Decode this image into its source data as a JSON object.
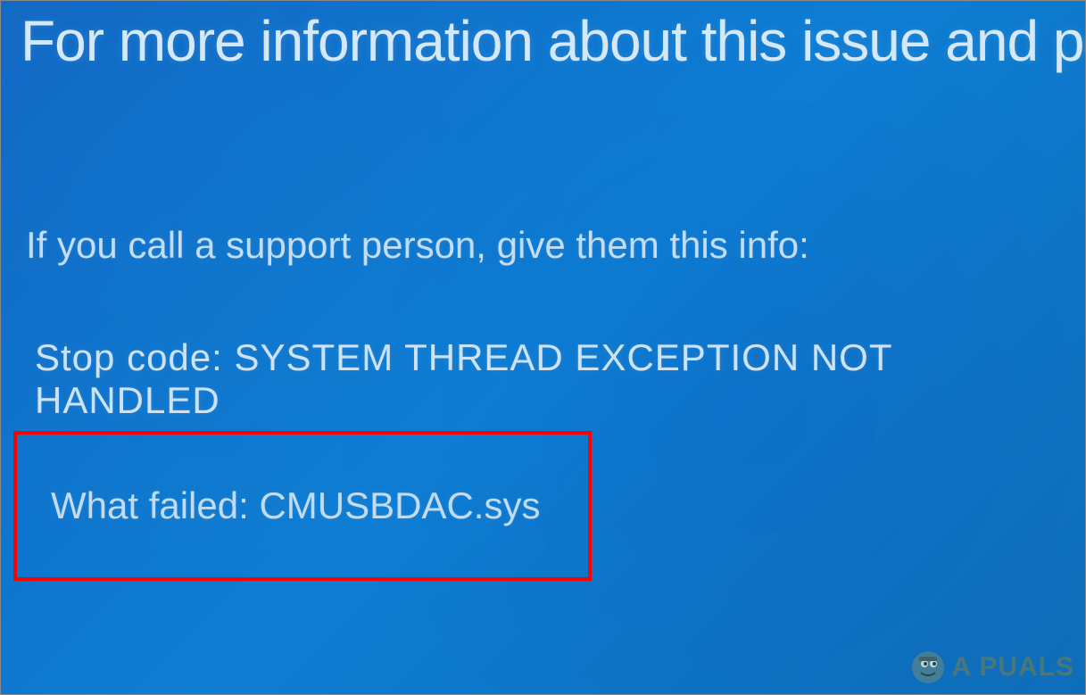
{
  "bsod": {
    "headline": "For more information about this issue and poss",
    "support_line": "If you call a support person, give them this info:",
    "stop_code_label": "Stop code:",
    "stop_code_value": "SYSTEM THREAD EXCEPTION NOT HANDLED",
    "what_failed_label": "What failed:",
    "what_failed_value": "CMUSBDAC.sys"
  },
  "watermark": {
    "brand": "A PUALS",
    "icon_name": "appuals-logo"
  },
  "colors": {
    "background_primary": "#0d7dd3",
    "text": "#c8e0f5",
    "highlight_box": "#ff0000"
  }
}
